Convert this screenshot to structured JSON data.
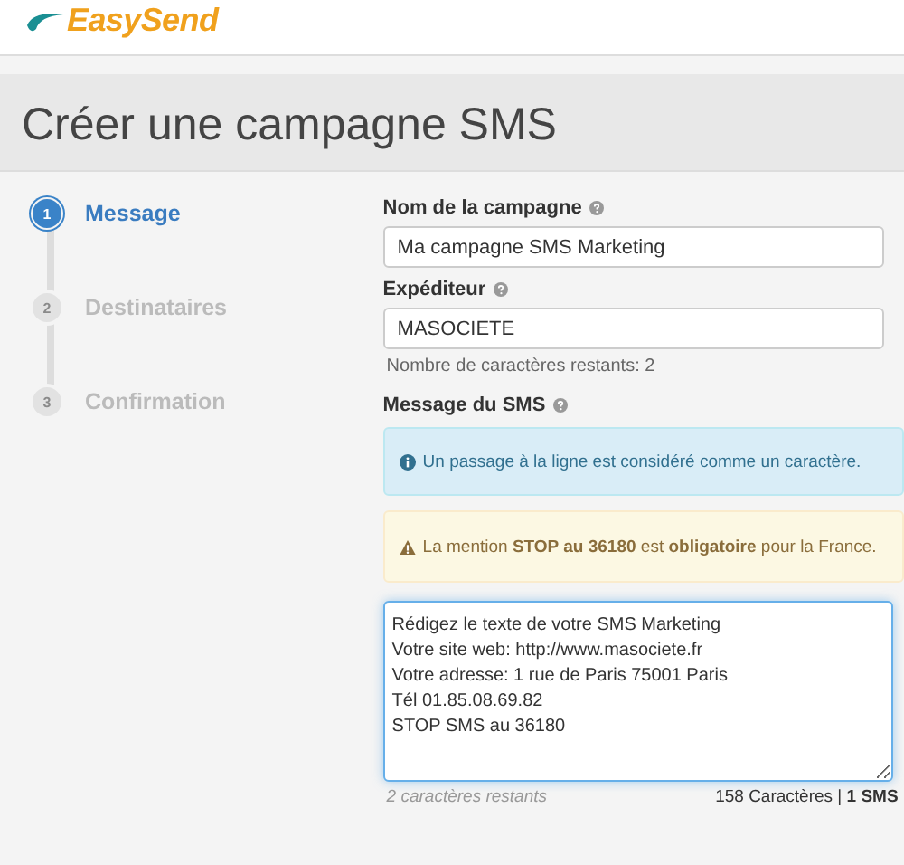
{
  "logo": {
    "text": "EasySend"
  },
  "page_title": "Créer une campagne SMS",
  "steps": [
    {
      "number": "1",
      "label": "Message",
      "selected": true
    },
    {
      "number": "2",
      "label": "Destinataires",
      "selected": false
    },
    {
      "number": "3",
      "label": "Confirmation",
      "selected": false
    }
  ],
  "form": {
    "campaign_name": {
      "label": "Nom de la campagne",
      "value": "Ma campagne SMS Marketing"
    },
    "sender": {
      "label": "Expéditeur",
      "value": "MASOCIETE",
      "hint": "Nombre de caractères restants: 2"
    },
    "message": {
      "label": "Message du SMS",
      "alerts": [
        {
          "kind": "info",
          "text": "Un passage à la ligne est considéré comme un caractère."
        },
        {
          "kind": "warning",
          "text": "La mention **STOP au 36180** est **obligatoire** pour la France."
        }
      ],
      "lines": [
        "Rédigez le texte de votre SMS Marketing",
        "Votre site web: http://www.masociete.fr",
        "Votre adresse: 1 rue de Paris 75001 Paris",
        "Tél 01.85.08.69.82",
        "STOP SMS au 36180"
      ],
      "remaining": "2 caractères restants",
      "count": "158 Caractères | **1 SMS**"
    }
  }
}
